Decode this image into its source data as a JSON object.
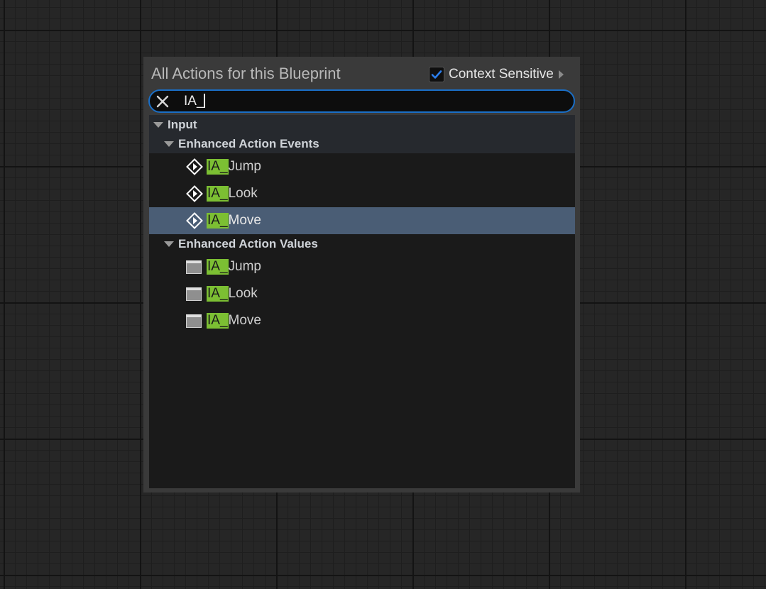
{
  "panel": {
    "title": "All Actions for this Blueprint",
    "context_sensitive": {
      "label": "Context Sensitive",
      "checked": true
    }
  },
  "search": {
    "value": "IA_",
    "clear_icon": "close-icon"
  },
  "tree": {
    "input": {
      "label": "Input",
      "icon": "triangle-down-icon"
    },
    "events": {
      "label": "Enhanced Action Events",
      "icon": "triangle-down-icon",
      "items": [
        {
          "match": "IA_",
          "rest": "Jump",
          "icon": "event-node-icon",
          "selected": false
        },
        {
          "match": "IA_",
          "rest": "Look",
          "icon": "event-node-icon",
          "selected": false
        },
        {
          "match": "IA_",
          "rest": "Move",
          "icon": "event-node-icon",
          "selected": true
        }
      ]
    },
    "values": {
      "label": "Enhanced Action Values",
      "icon": "triangle-down-icon",
      "items": [
        {
          "match": "IA_",
          "rest": "Jump",
          "icon": "function-node-icon"
        },
        {
          "match": "IA_",
          "rest": "Look",
          "icon": "function-node-icon"
        },
        {
          "match": "IA_",
          "rest": "Move",
          "icon": "function-node-icon"
        }
      ]
    }
  },
  "colors": {
    "search_border": "#1a6fc7",
    "match_highlight": "#7cbf33",
    "selected_row": "#4a5d75",
    "checkbox_check": "#2b7de9"
  }
}
